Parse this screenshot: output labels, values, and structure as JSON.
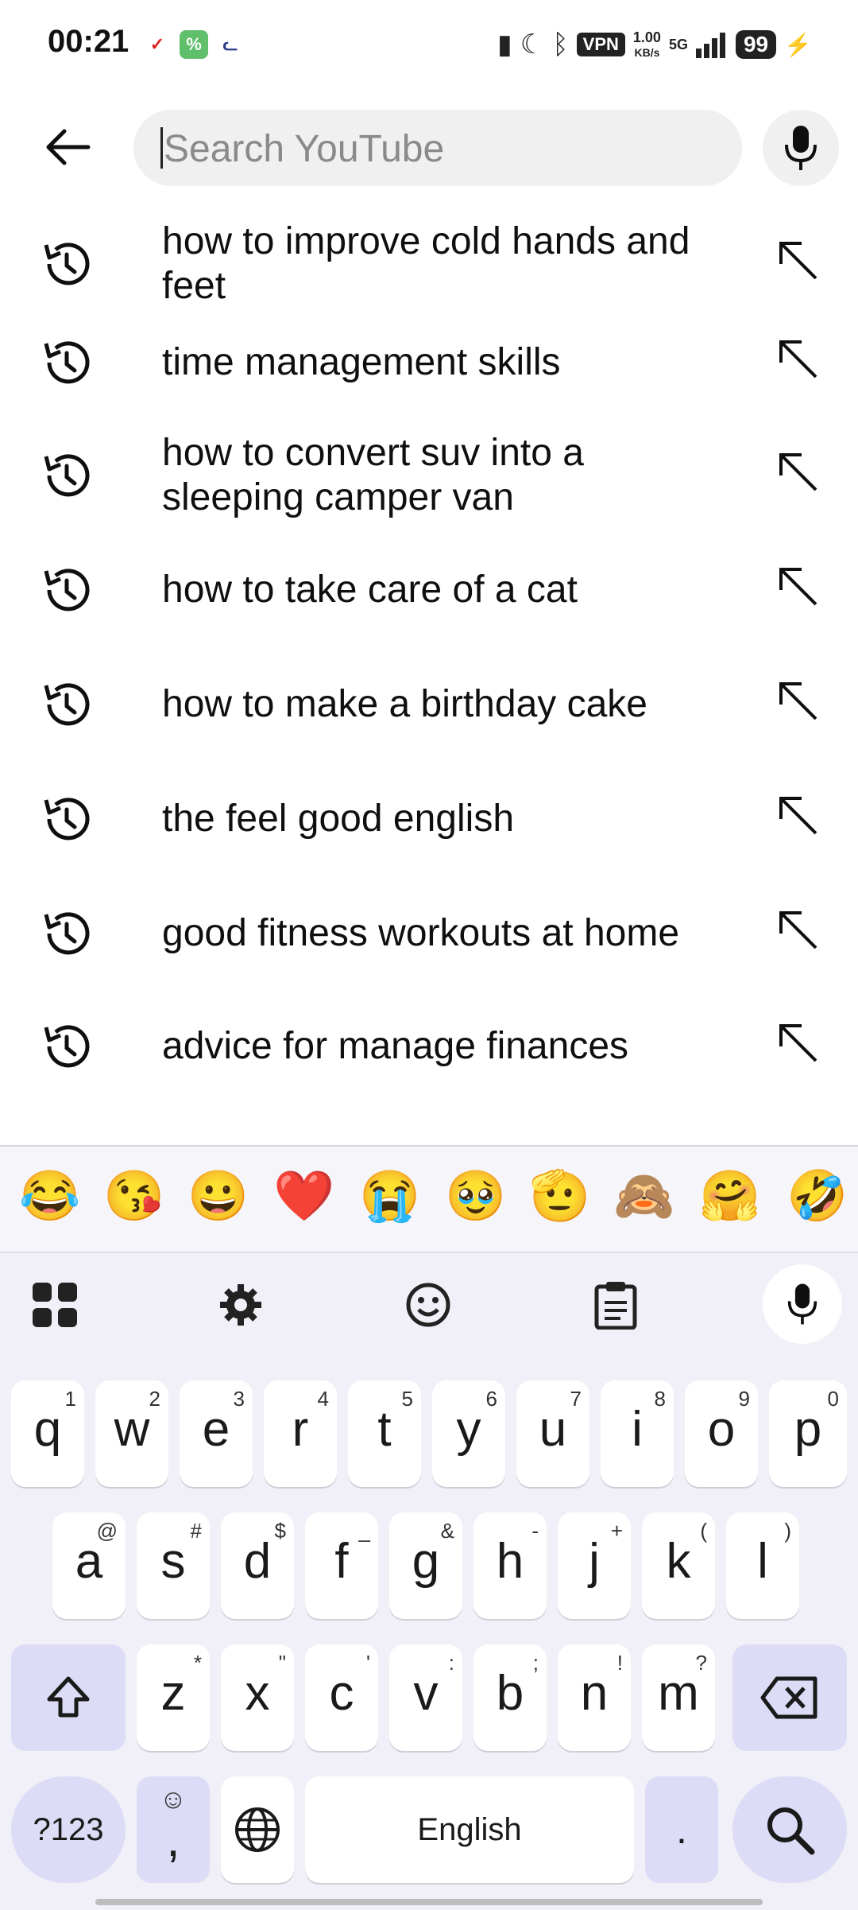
{
  "status": {
    "time": "00:21",
    "apps": [
      "news-app-icon",
      "wechat-app-icon",
      "cat-app-icon"
    ],
    "vpn": "VPN",
    "net_speed": "1.00",
    "net_unit": "KB/s",
    "network": "5G",
    "battery": "99"
  },
  "search": {
    "placeholder": "Search YouTube",
    "value": ""
  },
  "suggestions": [
    {
      "text": "how to improve cold hands and feet"
    },
    {
      "text": "time management skills"
    },
    {
      "text": "how to convert suv into a sleeping camper van"
    },
    {
      "text": "how to take care of a cat"
    },
    {
      "text": "how to make a birthday cake"
    },
    {
      "text": "the feel good english"
    },
    {
      "text": "good fitness workouts at home"
    },
    {
      "text": "advice for manage finances"
    }
  ],
  "keyboard": {
    "emojis": [
      "😂",
      "😘",
      "😀",
      "❤️",
      "😭",
      "🥹",
      "🫡",
      "🙈",
      "🤗",
      "🤣"
    ],
    "row1": [
      {
        "k": "q",
        "h": "1"
      },
      {
        "k": "w",
        "h": "2"
      },
      {
        "k": "e",
        "h": "3"
      },
      {
        "k": "r",
        "h": "4"
      },
      {
        "k": "t",
        "h": "5"
      },
      {
        "k": "y",
        "h": "6"
      },
      {
        "k": "u",
        "h": "7"
      },
      {
        "k": "i",
        "h": "8"
      },
      {
        "k": "o",
        "h": "9"
      },
      {
        "k": "p",
        "h": "0"
      }
    ],
    "row2": [
      {
        "k": "a",
        "h": "@"
      },
      {
        "k": "s",
        "h": "#"
      },
      {
        "k": "d",
        "h": "$"
      },
      {
        "k": "f",
        "h": "_"
      },
      {
        "k": "g",
        "h": "&"
      },
      {
        "k": "h",
        "h": "-"
      },
      {
        "k": "j",
        "h": "+"
      },
      {
        "k": "k",
        "h": "("
      },
      {
        "k": "l",
        "h": ")"
      }
    ],
    "row3": [
      {
        "k": "z",
        "h": "*"
      },
      {
        "k": "x",
        "h": "\""
      },
      {
        "k": "c",
        "h": "'"
      },
      {
        "k": "v",
        "h": ":"
      },
      {
        "k": "b",
        "h": ";"
      },
      {
        "k": "n",
        "h": "!"
      },
      {
        "k": "m",
        "h": "?"
      }
    ],
    "symbols_label": "?123",
    "comma_label": ",",
    "space_label": "English",
    "period_label": "."
  }
}
